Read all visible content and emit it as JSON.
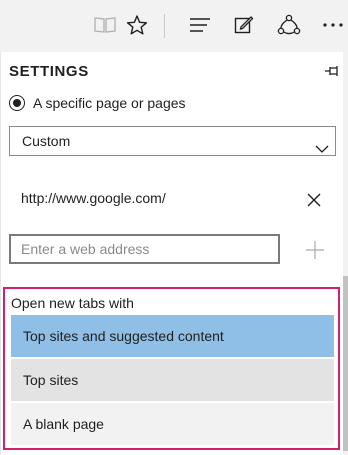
{
  "toolbar": {
    "icons": [
      "reading-view-icon",
      "favorites-star-icon",
      "hub-icon",
      "web-note-icon",
      "share-icon",
      "more-icon"
    ]
  },
  "settings": {
    "title": "SETTINGS",
    "startup": {
      "selected_option": "A specific page or pages",
      "pages_select_value": "Custom",
      "pages": [
        "http://www.google.com/"
      ],
      "address_placeholder": "Enter a web address"
    },
    "new_tabs": {
      "label": "Open new tabs with",
      "options": [
        "Top sites and suggested content",
        "Top sites",
        "A blank page"
      ],
      "highlighted_index": 0
    }
  },
  "colors": {
    "focus_border": "#d0206e",
    "option_highlight": "#8fbfe6",
    "option_hover": "#e3e3e3"
  }
}
